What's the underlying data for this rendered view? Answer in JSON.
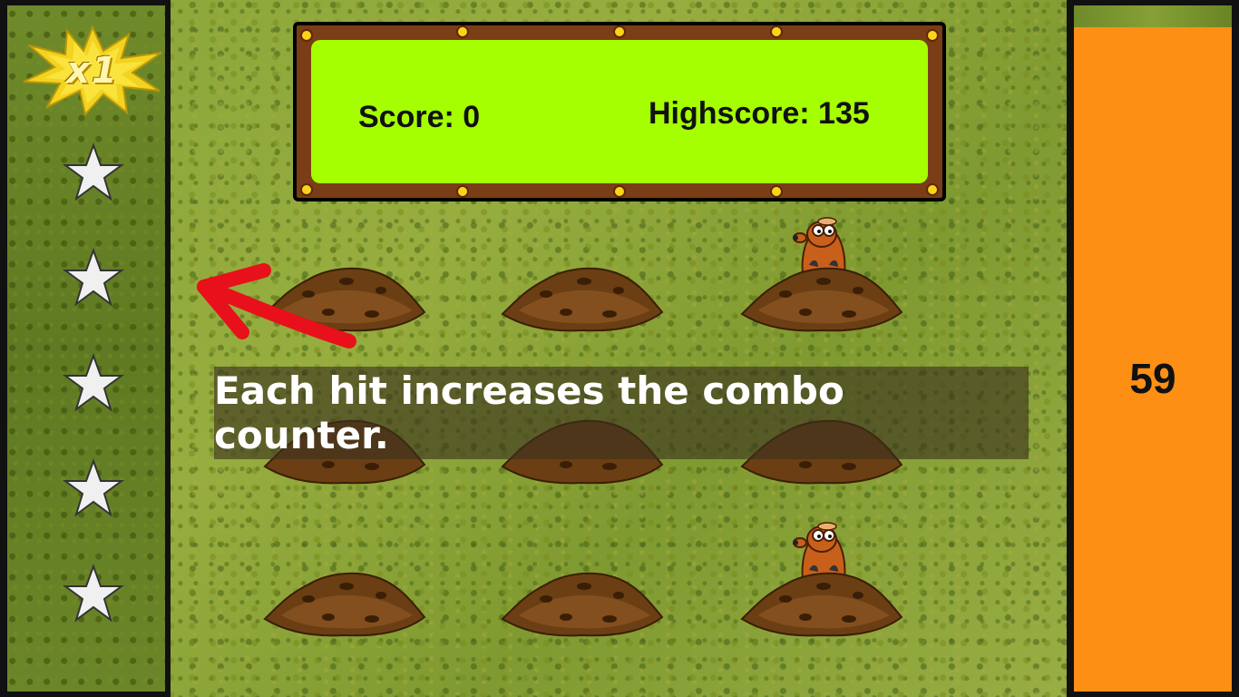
{
  "combo": {
    "multiplier_text": "x1",
    "stars_total": 5,
    "stars_filled": 0
  },
  "scoreboard": {
    "score_label": "Score: 0",
    "highscore_label": "Highscore: 135"
  },
  "timer": {
    "value": "59"
  },
  "tutorial": {
    "message": "Each hit increases the combo counter."
  },
  "field": {
    "holes": 9,
    "visible_moles_in_holes": [
      3,
      9
    ]
  },
  "colors": {
    "timer_bar": "#fd8f14",
    "scoreboard_fill": "#a5ff00",
    "scoreboard_frame": "#7a3d15",
    "arrow": "#e8101a"
  }
}
